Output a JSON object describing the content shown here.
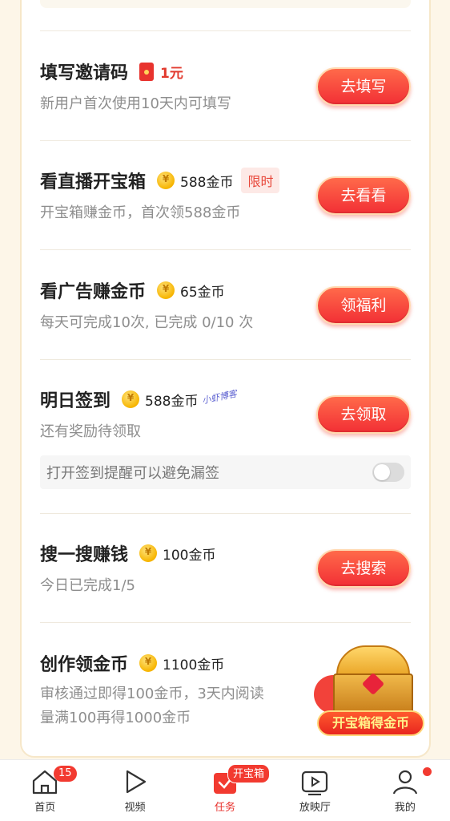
{
  "tasks": [
    {
      "title": "填写邀请码",
      "reward": "1元",
      "desc": "新用户首次使用10天内可填写",
      "button": "去填写"
    },
    {
      "title": "看直播开宝箱",
      "reward": "588金币",
      "tag": "限时",
      "desc": "开宝箱赚金币，首次领588金币",
      "button": "去看看"
    },
    {
      "title": "看广告赚金币",
      "reward": "65金币",
      "desc": "每天可完成10次, 已完成 0/10 次",
      "button": "领福利"
    },
    {
      "title": "明日签到",
      "reward": "588金币",
      "desc": "还有奖励待领取",
      "button": "去领取",
      "reminder": "打开签到提醒可以避免漏签",
      "reminder_on": false
    },
    {
      "title": "搜一搜赚钱",
      "reward": "100金币",
      "desc": "今日已完成1/5",
      "button": "去搜索"
    },
    {
      "title": "创作领金币",
      "reward": "1100金币",
      "desc_line1": "审核通过即得100金币，3天内阅读",
      "desc_line2": "量满100再得1000金币"
    }
  ],
  "watermark": "小虾博客",
  "chest": {
    "label": "开宝箱得金币"
  },
  "nav": {
    "items": [
      {
        "label": "首页",
        "icon": "home-icon",
        "badge": "15"
      },
      {
        "label": "视频",
        "icon": "play-icon"
      },
      {
        "label": "任务",
        "icon": "task-icon",
        "badge": "开宝箱",
        "active": true
      },
      {
        "label": "放映厅",
        "icon": "tv-icon"
      },
      {
        "label": "我的",
        "icon": "user-icon",
        "dot": true
      }
    ]
  },
  "colors": {
    "accent": "#f23a30",
    "button": "#f22f35",
    "coin": "#f7b500"
  }
}
